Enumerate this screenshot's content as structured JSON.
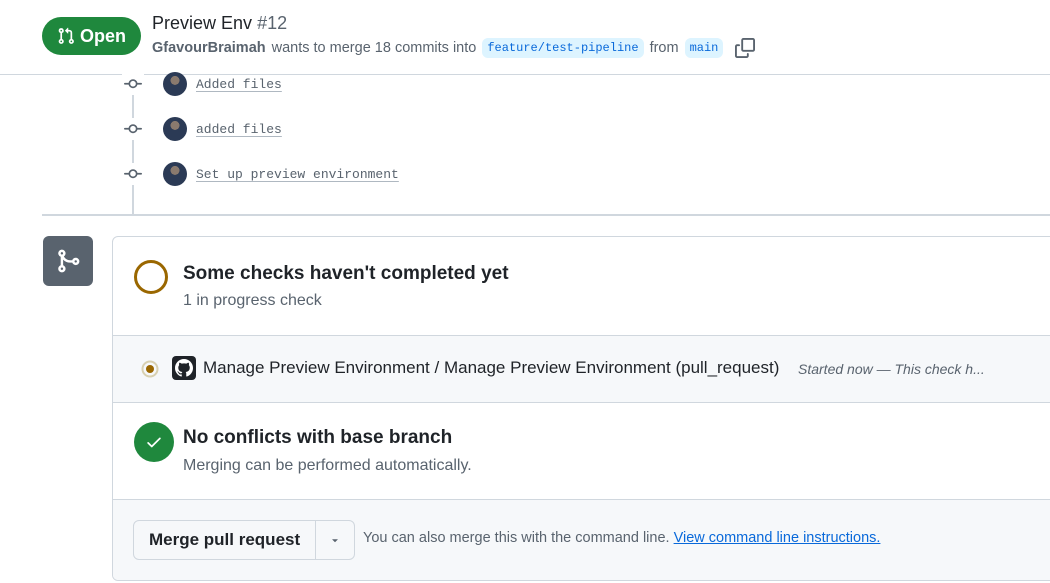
{
  "pr": {
    "state": "Open",
    "title": "Preview Env",
    "number": "#12",
    "author": "GfavourBraimah",
    "merge_text_1": "wants to merge 18 commits into",
    "base_branch": "feature/test-pipeline",
    "merge_text_2": "from",
    "head_branch": "main"
  },
  "commits": [
    {
      "message": "Added files"
    },
    {
      "message": "added files"
    },
    {
      "message": "Set up preview environment"
    }
  ],
  "merge_box": {
    "checks_title": "Some checks haven't completed yet",
    "checks_subtitle": "1 in progress check",
    "check_item": {
      "name": "Manage Preview Environment / Manage Preview Environment (pull_request)",
      "description": "Started now — This check h..."
    },
    "conflicts_title": "No conflicts with base branch",
    "conflicts_subtitle": "Merging can be performed automatically.",
    "merge_button": "Merge pull request",
    "hint_text": "You can also merge this with the command line.",
    "hint_link": "View command line instructions."
  },
  "colors": {
    "open_green": "#1f883d",
    "pending": "#9a6700",
    "link": "#0969da",
    "branch_bg": "#ddf4ff"
  },
  "icons": [
    "git-pull-request-icon",
    "copy-icon",
    "git-commit-icon",
    "git-merge-icon",
    "dot-fill-icon",
    "github-icon",
    "check-icon",
    "triangle-down-icon"
  ]
}
